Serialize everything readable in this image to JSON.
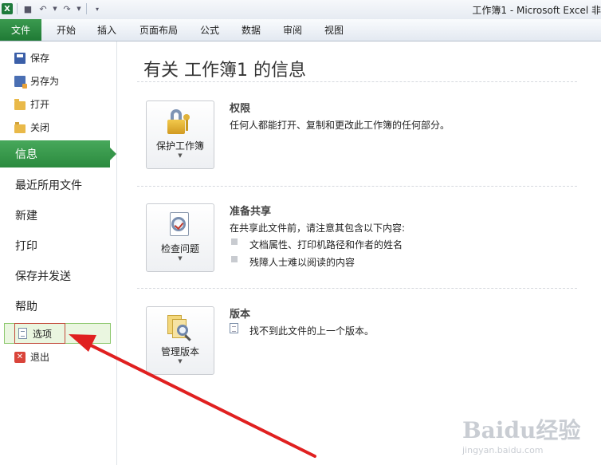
{
  "titlebar": {
    "title": "工作簿1 - Microsoft Excel 非",
    "app_icon": "X"
  },
  "ribbon": {
    "file_tab": "文件",
    "tabs": [
      "开始",
      "插入",
      "页面布局",
      "公式",
      "数据",
      "审阅",
      "视图"
    ]
  },
  "sidebar": {
    "save": "保存",
    "save_as": "另存为",
    "open": "打开",
    "close": "关闭",
    "info": "信息",
    "recent": "最近所用文件",
    "new": "新建",
    "print": "打印",
    "save_send": "保存并发送",
    "help": "帮助",
    "options": "选项",
    "exit": "退出"
  },
  "main": {
    "title": "有关 工作簿1 的信息",
    "permissions": {
      "button": "保护工作簿",
      "title": "权限",
      "text": "任何人都能打开、复制和更改此工作簿的任何部分。"
    },
    "prepare": {
      "button": "检查问题",
      "title": "准备共享",
      "text": "在共享此文件前，请注意其包含以下内容:",
      "bullets": [
        "文档属性、打印机路径和作者的姓名",
        "残障人士难以阅读的内容"
      ]
    },
    "versions": {
      "button": "管理版本",
      "title": "版本",
      "text": "找不到此文件的上一个版本。"
    }
  },
  "watermark": {
    "main": "Baidu经验",
    "sub": "jingyan.baidu.com"
  },
  "colors": {
    "accent_green": "#2b8a3e",
    "arrow_red": "#e02020"
  }
}
